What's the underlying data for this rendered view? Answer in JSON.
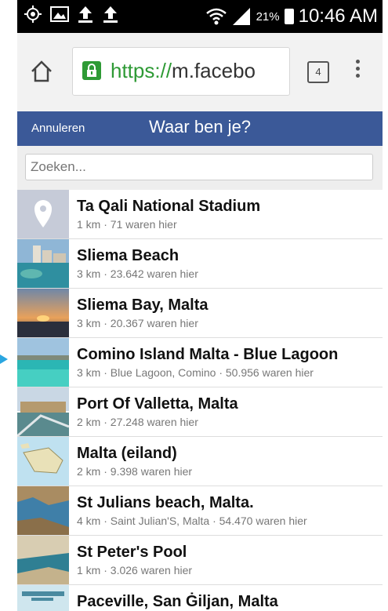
{
  "status": {
    "battery": "21%",
    "time": "10:46 AM",
    "icons": [
      "gps-icon",
      "image-icon",
      "upload-icon",
      "upload-icon",
      "wifi-icon",
      "signal-icon",
      "battery-icon"
    ]
  },
  "browser": {
    "url_scheme": "https://",
    "url_rest": "m.facebo",
    "tab_count": "4"
  },
  "header": {
    "cancel": "Annuleren",
    "title": "Waar ben je?"
  },
  "search": {
    "placeholder": "Zoeken..."
  },
  "places": [
    {
      "name": "Ta Qali National Stadium",
      "meta": "1 km · 71 waren hier"
    },
    {
      "name": "Sliema Beach",
      "meta": "3 km · 23.642 waren hier"
    },
    {
      "name": "Sliema Bay, Malta",
      "meta": "3 km · 20.367 waren hier"
    },
    {
      "name": "Comino Island Malta - Blue Lagoon",
      "meta": "3 km · Blue Lagoon, Comino · 50.956 waren hier"
    },
    {
      "name": "Port Of Valletta, Malta",
      "meta": "2 km · 27.248 waren hier"
    },
    {
      "name": "Malta (eiland)",
      "meta": "2 km · 9.398 waren hier"
    },
    {
      "name": "St Julians beach, Malta.",
      "meta": "4 km · Saint Julian'S, Malta · 54.470 waren hier"
    },
    {
      "name": "St Peter's Pool",
      "meta": "1 km · 3.026 waren hier"
    },
    {
      "name": "Paceville, San Ġiljan, Malta",
      "meta": ""
    }
  ]
}
